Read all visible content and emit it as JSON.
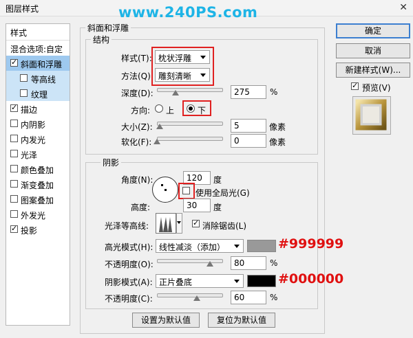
{
  "window": {
    "title": "图层样式",
    "close_glyph": "✕"
  },
  "watermark": "www.240PS.com",
  "left_list": {
    "header": "样式",
    "blend": "混合选项:自定",
    "items": [
      {
        "label": "斜面和浮雕",
        "checked": true
      },
      {
        "label": "等高线",
        "checked": false
      },
      {
        "label": "纹理",
        "checked": false
      },
      {
        "label": "描边",
        "checked": true
      },
      {
        "label": "内阴影",
        "checked": false
      },
      {
        "label": "内发光",
        "checked": false
      },
      {
        "label": "光泽",
        "checked": false
      },
      {
        "label": "颜色叠加",
        "checked": false
      },
      {
        "label": "渐变叠加",
        "checked": false
      },
      {
        "label": "图案叠加",
        "checked": false
      },
      {
        "label": "外发光",
        "checked": false
      },
      {
        "label": "投影",
        "checked": true
      }
    ]
  },
  "bevel": {
    "group_title": "斜面和浮雕",
    "structure_title": "结构",
    "style_label": "样式(T):",
    "style_value": "枕状浮雕",
    "technique_label": "方法(Q):",
    "technique_value": "雕刻清晰",
    "depth_label": "深度(D):",
    "depth_value": "275",
    "depth_unit": "%",
    "direction_label": "方向:",
    "dir_up": "上",
    "dir_down": "下",
    "size_label": "大小(Z):",
    "size_value": "5",
    "size_unit": "像素",
    "soften_label": "软化(F):",
    "soften_value": "0",
    "soften_unit": "像素"
  },
  "shading": {
    "title": "阴影",
    "angle_label": "角度(N):",
    "angle_value": "120",
    "angle_unit": "度",
    "global_light_label": "使用全局光(G)",
    "altitude_label": "高度:",
    "altitude_value": "30",
    "altitude_unit": "度",
    "gloss_label": "光泽等高线:",
    "antialias_label": "消除锯齿(L)",
    "highlight_mode_label": "高光模式(H):",
    "highlight_mode_value": "线性减淡（添加）",
    "highlight_color": "#999999",
    "highlight_hex": "#999999",
    "highlight_opacity_label": "不透明度(O):",
    "highlight_opacity_value": "80",
    "highlight_opacity_unit": "%",
    "shadow_mode_label": "阴影模式(A):",
    "shadow_mode_value": "正片叠底",
    "shadow_color": "#000000",
    "shadow_hex": "#000000",
    "shadow_opacity_label": "不透明度(C):",
    "shadow_opacity_value": "60",
    "shadow_opacity_unit": "%"
  },
  "bottom_buttons": {
    "set_default": "设置为默认值",
    "reset_default": "复位为默认值"
  },
  "right_buttons": {
    "ok": "确定",
    "cancel": "取消",
    "new_style": "新建样式(W)...",
    "preview": "预览(V)"
  }
}
